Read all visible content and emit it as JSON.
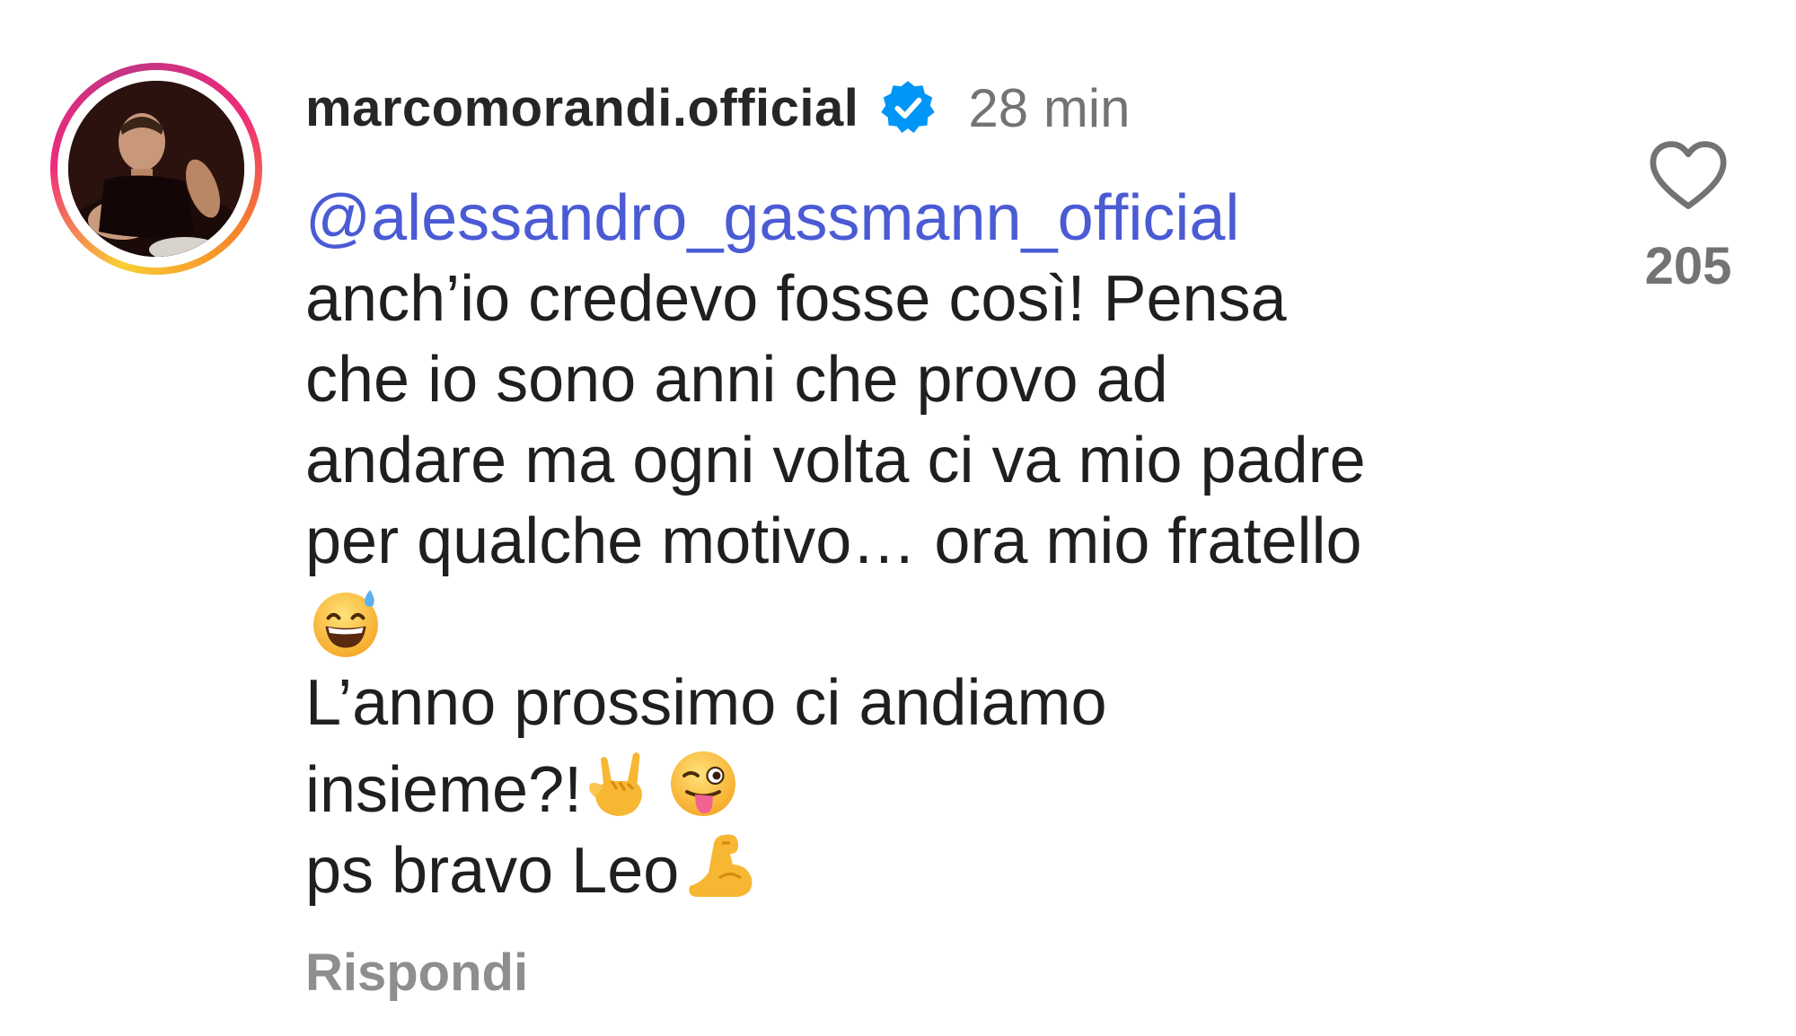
{
  "comment": {
    "username": "marcomorandi.official",
    "verified_icon": "verified-badge-icon",
    "timestamp": "28 min",
    "mention": "@alessandro_gassmann_official",
    "lines": [
      "anch’io credevo fosse così! Pensa",
      "che io sono anni che provo ad",
      "andare ma ogni volta ci va mio padre",
      "per qualche motivo… ora mio fratello",
      "L’anno prossimo ci andiamo",
      "insieme?!",
      "ps bravo Leo"
    ],
    "emojis": [
      "grinning-sweat-emoji",
      "rock-hand-emoji",
      "winking-tongue-emoji",
      "flexed-biceps-emoji"
    ],
    "reply_label": "Rispondi",
    "likes": "205",
    "accent_colors": {
      "mention": "#4a5bd4",
      "verified": "#0095f6",
      "muted": "#737373"
    }
  }
}
